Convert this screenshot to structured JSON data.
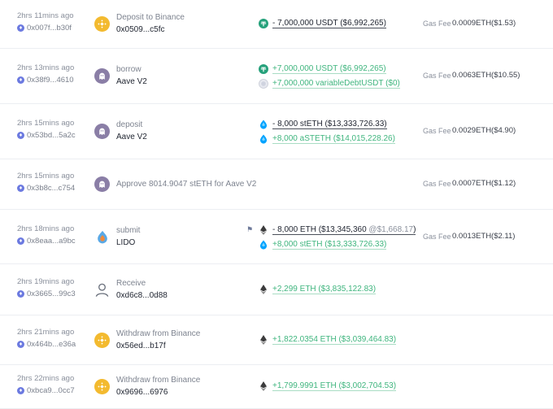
{
  "transactions": [
    {
      "time": "2hrs 11mins ago",
      "hash": "0x007f...b30f",
      "protocol": "binance",
      "protocol_icon": "binance-icon",
      "action": "Deposit to Binance",
      "target": "0x0509...c5fc",
      "tokens": [
        {
          "direction": "out",
          "icon": "tether-icon",
          "text": "- 7,000,000 USDT ($6,992,265)"
        }
      ],
      "fee_label": "Gas Fee",
      "fee": "0.0009ETH($1.53)"
    },
    {
      "time": "2hrs 13mins ago",
      "hash": "0x38f9...4610",
      "protocol": "aave",
      "protocol_icon": "aave-ghost-icon",
      "action": "borrow",
      "target": "Aave V2",
      "tokens": [
        {
          "direction": "in",
          "icon": "tether-icon",
          "text": "+7,000,000 USDT ($6,992,265)"
        },
        {
          "direction": "in",
          "icon": "debt-token-icon",
          "text": "+7,000,000 variableDebtUSDT ($0)"
        }
      ],
      "fee_label": "Gas Fee",
      "fee": "0.0063ETH($10.55)"
    },
    {
      "time": "2hrs 15mins ago",
      "hash": "0x53bd...5a2c",
      "protocol": "aave",
      "protocol_icon": "aave-ghost-icon",
      "action": "deposit",
      "target": "Aave V2",
      "tokens": [
        {
          "direction": "out",
          "icon": "steth-icon",
          "text": "- 8,000 stETH ($13,333,726.33)"
        },
        {
          "direction": "in",
          "icon": "steth-icon",
          "text": "+8,000 aSTETH ($14,015,228.26)"
        }
      ],
      "fee_label": "Gas Fee",
      "fee": "0.0029ETH($4.90)"
    },
    {
      "time": "2hrs 15mins ago",
      "hash": "0x3b8c...c754",
      "protocol": "aave",
      "protocol_icon": "aave-ghost-icon",
      "action": "Approve 8014.9047 stETH for Aave V2",
      "target": "",
      "tokens": [],
      "fee_label": "Gas Fee",
      "fee": "0.0007ETH($1.12)"
    },
    {
      "time": "2hrs 18mins ago",
      "hash": "0x8eaa...a9bc",
      "protocol": "lido",
      "protocol_icon": "lido-drop-icon",
      "action": "submit",
      "target": "LIDO",
      "flag": true,
      "tokens": [
        {
          "direction": "out",
          "icon": "eth-icon",
          "text": "- 8,000 ETH ($13,345,360 ",
          "extra": "@$1,668.17",
          "close": ")"
        },
        {
          "direction": "in",
          "icon": "steth-icon",
          "text": "+8,000 stETH ($13,333,726.33)"
        }
      ],
      "fee_label": "Gas Fee",
      "fee": "0.0013ETH($2.11)"
    },
    {
      "time": "2hrs 19mins ago",
      "hash": "0x3665...99c3",
      "protocol": "user",
      "protocol_icon": "user-icon",
      "action": "Receive",
      "target": "0xd6c8...0d88",
      "tokens": [
        {
          "direction": "in",
          "icon": "eth-icon",
          "text": "+2,299 ETH ($3,835,122.83)"
        }
      ],
      "fee_label": "",
      "fee": ""
    },
    {
      "time": "2hrs 21mins ago",
      "hash": "0x464b...e36a",
      "protocol": "binance",
      "protocol_icon": "binance-icon",
      "action": "Withdraw from Binance",
      "target": "0x56ed...b17f",
      "tokens": [
        {
          "direction": "in",
          "icon": "eth-icon",
          "text": "+1,822.0354 ETH ($3,039,464.83)"
        }
      ],
      "fee_label": "",
      "fee": ""
    },
    {
      "time": "2hrs 22mins ago",
      "hash": "0xbca9...0cc7",
      "protocol": "binance",
      "protocol_icon": "binance-icon",
      "action": "Withdraw from Binance",
      "target": "0x9696...6976",
      "tokens": [
        {
          "direction": "in",
          "icon": "eth-icon",
          "text": "+1,799.9991 ETH ($3,002,704.53)"
        }
      ],
      "fee_label": "",
      "fee": ""
    }
  ],
  "colors": {
    "incoming": "#3fb57e",
    "outgoing": "#1f2430",
    "binance": "#f3ba2f",
    "aave": "#8a7ea6",
    "eth_chain": "#6c7ae0"
  }
}
